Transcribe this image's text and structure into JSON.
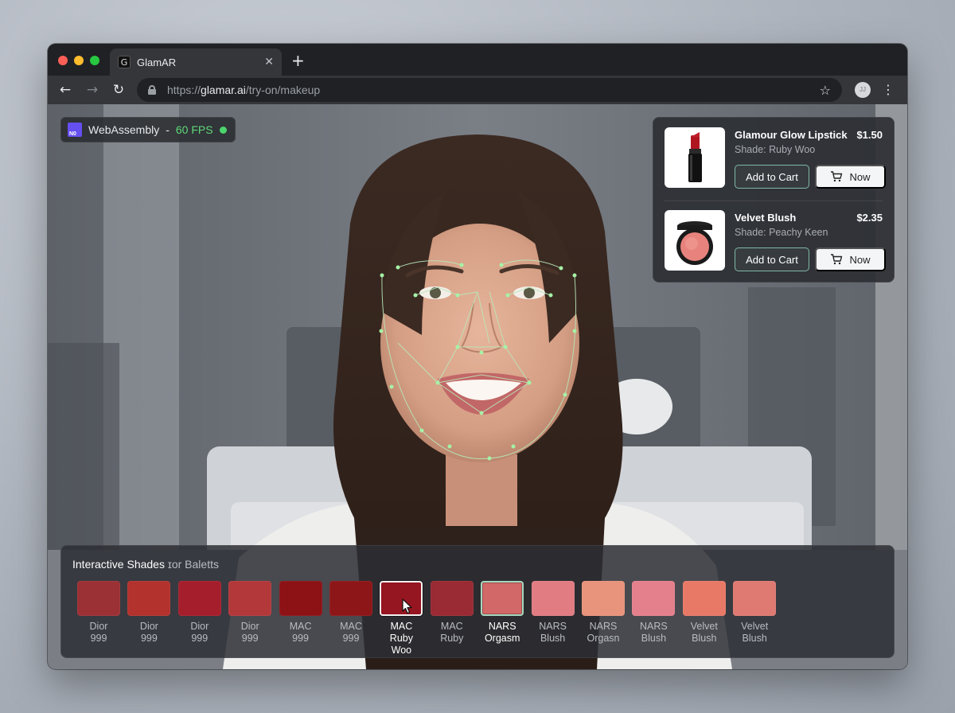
{
  "browser": {
    "tab_title": "GlamAR",
    "favicon_letter": "G",
    "url_scheme": "https://",
    "url_host": "glamar.ai",
    "url_path": "/try-on/makeup",
    "profile_initials": "JJ"
  },
  "status": {
    "engine": "WebAssembly",
    "separator": "-",
    "fps": "60 FPS"
  },
  "products": [
    {
      "name": "Glamour Glow Lipstick",
      "price": "$1.50",
      "shade": "Shade: Ruby Woo",
      "add_label": "Add to Cart",
      "now_label": "Now",
      "icon": "lipstick-icon"
    },
    {
      "name": "Velvet Blush",
      "price": "$2.35",
      "shade": "Shade: Peachy Keen",
      "add_label": "Add to Cart",
      "now_label": "Now",
      "icon": "blush-compact-icon"
    }
  ],
  "shades_panel": {
    "title": "Interactive Shades",
    "subtitle": "ɪor Baletts",
    "swatches": [
      {
        "brand": "Dior",
        "name": "999",
        "color": "#9b3035"
      },
      {
        "brand": "Dior",
        "name": "999",
        "color": "#b3322d"
      },
      {
        "brand": "Dior",
        "name": "999",
        "color": "#a51e2c"
      },
      {
        "brand": "Dior",
        "name": "999",
        "color": "#b3383a"
      },
      {
        "brand": "MAC",
        "name": "999",
        "color": "#8c1216"
      },
      {
        "brand": "MAC",
        "name": "999",
        "color": "#8d1618"
      },
      {
        "brand": "MAC",
        "name": "Ruby Woo",
        "color": "#951520",
        "state": "selected"
      },
      {
        "brand": "MAC",
        "name": "Ruby",
        "color": "#9a2a33"
      },
      {
        "brand": "NARS",
        "name": "Orgasm",
        "color": "#d26867",
        "state": "outlined"
      },
      {
        "brand": "NARS",
        "name": "Blush",
        "color": "#e07c82"
      },
      {
        "brand": "NARS",
        "name": "Orgasn",
        "color": "#e8937b"
      },
      {
        "brand": "NARS",
        "name": "Blush",
        "color": "#e47f8c"
      },
      {
        "brand": "Velvet",
        "name": "Blush",
        "color": "#e87967"
      },
      {
        "brand": "Velvet",
        "name": "Blush",
        "color": "#de7a72"
      }
    ]
  },
  "colors": {
    "accent_green": "#5fd87a",
    "button_outline": "#7fb9a7",
    "landmark_green": "#9be39b"
  }
}
